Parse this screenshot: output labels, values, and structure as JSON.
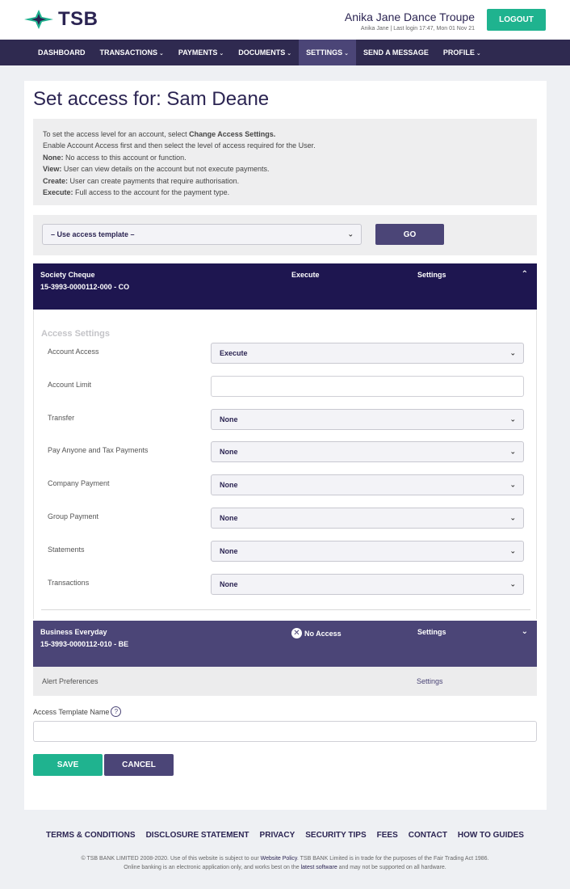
{
  "header": {
    "logo_text": "TSB",
    "org_name": "Anika Jane Dance Troupe",
    "last_login": "Anika Jane | Last login 17:47, Mon 01 Nov 21",
    "logout_label": "LOGOUT"
  },
  "nav": {
    "items": [
      {
        "label": "DASHBOARD",
        "dropdown": false
      },
      {
        "label": "TRANSACTIONS",
        "dropdown": true
      },
      {
        "label": "PAYMENTS",
        "dropdown": true
      },
      {
        "label": "DOCUMENTS",
        "dropdown": true
      },
      {
        "label": "SETTINGS",
        "dropdown": true,
        "active": true
      },
      {
        "label": "SEND A MESSAGE",
        "dropdown": false
      },
      {
        "label": "PROFILE",
        "dropdown": true
      }
    ],
    "caret": "⌄"
  },
  "page": {
    "title": "Set access for: Sam Deane"
  },
  "info": {
    "line1_prefix": "To set the access level for an account, select ",
    "line1_bold": "Change Access Settings.",
    "line2": "Enable Account Access first and then select the level of access required for the User.",
    "none_term": "None:",
    "none_desc": " No access to this account or function.",
    "view_term": "View:",
    "view_desc": " User can view details on the account but not execute payments.",
    "create_term": "Create:",
    "create_desc": " User can create payments that require authorisation.",
    "execute_term": "Execute:",
    "execute_desc": " Full access to the account for the payment type."
  },
  "template": {
    "selected": "– Use access template –",
    "go_label": "GO"
  },
  "accounts": [
    {
      "name": "Society Cheque",
      "number": "15-3993-0000112-000 - CO",
      "access": "Execute",
      "settings": "Settings",
      "chevron": "⌃"
    },
    {
      "name": "Business Everyday",
      "number": "15-3993-0000112-010 - BE",
      "access": "No Access",
      "settings": "Settings",
      "chevron": "⌄"
    }
  ],
  "access_settings": {
    "title": "Access Settings",
    "rows": [
      {
        "label": "Account Access",
        "value": "Execute",
        "type": "select"
      },
      {
        "label": "Account Limit",
        "value": "",
        "type": "input"
      },
      {
        "label": "Transfer",
        "value": "None",
        "type": "select"
      },
      {
        "label": "Pay Anyone and Tax Payments",
        "value": "None",
        "type": "select"
      },
      {
        "label": "Company Payment",
        "value": "None",
        "type": "select"
      },
      {
        "label": "Group Payment",
        "value": "None",
        "type": "select"
      },
      {
        "label": "Statements",
        "value": "None",
        "type": "select"
      },
      {
        "label": "Transactions",
        "value": "None",
        "type": "select"
      }
    ]
  },
  "alerts": {
    "label": "Alert Preferences",
    "settings": "Settings"
  },
  "template_name": {
    "label": "Access Template Name",
    "help": "?",
    "value": ""
  },
  "actions": {
    "save_label": "SAVE",
    "cancel_label": "CANCEL"
  },
  "footer": {
    "links": [
      "TERMS & CONDITIONS",
      "DISCLOSURE STATEMENT",
      "PRIVACY",
      "SECURITY TIPS",
      "FEES",
      "CONTACT",
      "HOW TO GUIDES"
    ],
    "legal_a": "© TSB BANK LIMITED 2008-2020. Use of this website is subject to our ",
    "legal_link1": "Website Policy",
    "legal_b": ". TSB BANK Limited is in trade for the purposes of the Fair Trading Act 1986.",
    "legal_c": "Online banking is an electronic application only, and works best on the ",
    "legal_link2": "latest software",
    "legal_d": " and may not be supported on all hardware."
  },
  "colors": {
    "brand_navy": "#2b2452",
    "nav_bg": "#2f2a50",
    "accent_green": "#1fb38f",
    "accent_purple": "#4b4577",
    "account_active": "#1e1650"
  }
}
